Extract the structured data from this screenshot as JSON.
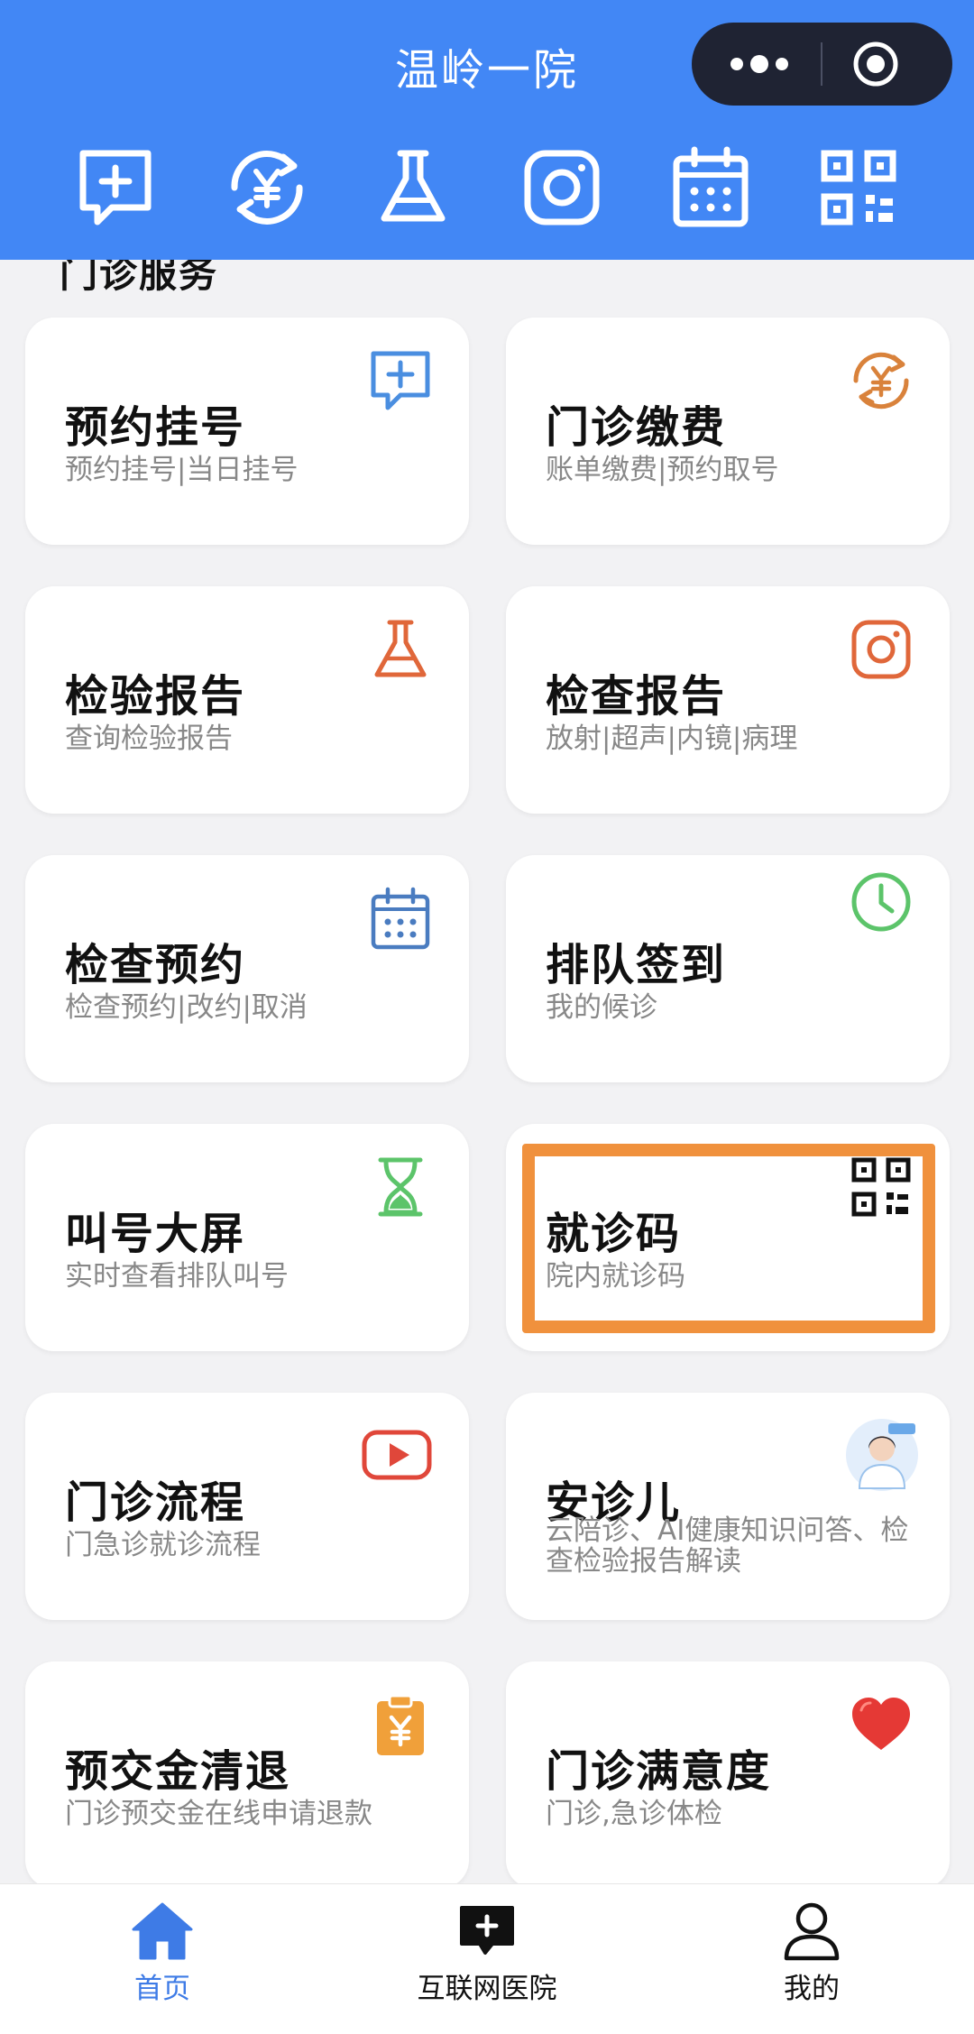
{
  "header": {
    "title": "温岭一院",
    "quick_icons": [
      "consult-plus-icon",
      "yuan-payment-icon",
      "flask-icon",
      "camera-icon",
      "calendar-icon",
      "qr-code-icon"
    ]
  },
  "section": {
    "title": "门诊服务"
  },
  "cards": [
    {
      "title": "预约挂号",
      "subtitle": "预约挂号|当日挂号",
      "icon": "consult-plus-icon",
      "color": "#4a8ee0"
    },
    {
      "title": "门诊缴费",
      "subtitle": "账单缴费|预约取号",
      "icon": "yuan-payment-icon",
      "color": "#d9823b"
    },
    {
      "title": "检验报告",
      "subtitle": "查询检验报告",
      "icon": "flask-icon",
      "color": "#e0673a"
    },
    {
      "title": "检查报告",
      "subtitle": "放射|超声|内镜|病理",
      "icon": "camera-icon",
      "color": "#e0673a"
    },
    {
      "title": "检查预约",
      "subtitle": "检查预约|改约|取消",
      "icon": "calendar-icon",
      "color": "#4a7cc0"
    },
    {
      "title": "排队签到",
      "subtitle": "我的候诊",
      "icon": "clock-icon",
      "color": "#5cc46a"
    },
    {
      "title": "叫号大屏",
      "subtitle": "实时查看排队叫号",
      "icon": "hourglass-icon",
      "color": "#5cc46a"
    },
    {
      "title": "就诊码",
      "subtitle": "院内就诊码",
      "icon": "qr-code-icon",
      "color": "#111111"
    },
    {
      "title": "门诊流程",
      "subtitle": "门急诊就诊流程",
      "icon": "video-play-icon",
      "color": "#e0473a"
    },
    {
      "title": "安诊儿",
      "subtitle": "云陪诊、AI健康知识问答、检查检验报告解读",
      "icon": "doctor-avatar-icon",
      "color": "#6aa8e8"
    },
    {
      "title": "预交金清退",
      "subtitle": "门诊预交金在线申请退款",
      "icon": "clipboard-yuan-icon",
      "color": "#f0a03a"
    },
    {
      "title": "门诊满意度",
      "subtitle": "门诊,急诊体检",
      "icon": "heart-icon",
      "color": "#e53935"
    }
  ],
  "tabbar": {
    "items": [
      {
        "label": "首页",
        "icon": "home-icon",
        "active": true
      },
      {
        "label": "互联网医院",
        "icon": "chat-plus-icon",
        "active": false
      },
      {
        "label": "我的",
        "icon": "user-icon",
        "active": false
      }
    ]
  },
  "colors": {
    "primary": "#4287f5",
    "highlight": "#f0913d",
    "tab_active": "#3e7be6"
  }
}
